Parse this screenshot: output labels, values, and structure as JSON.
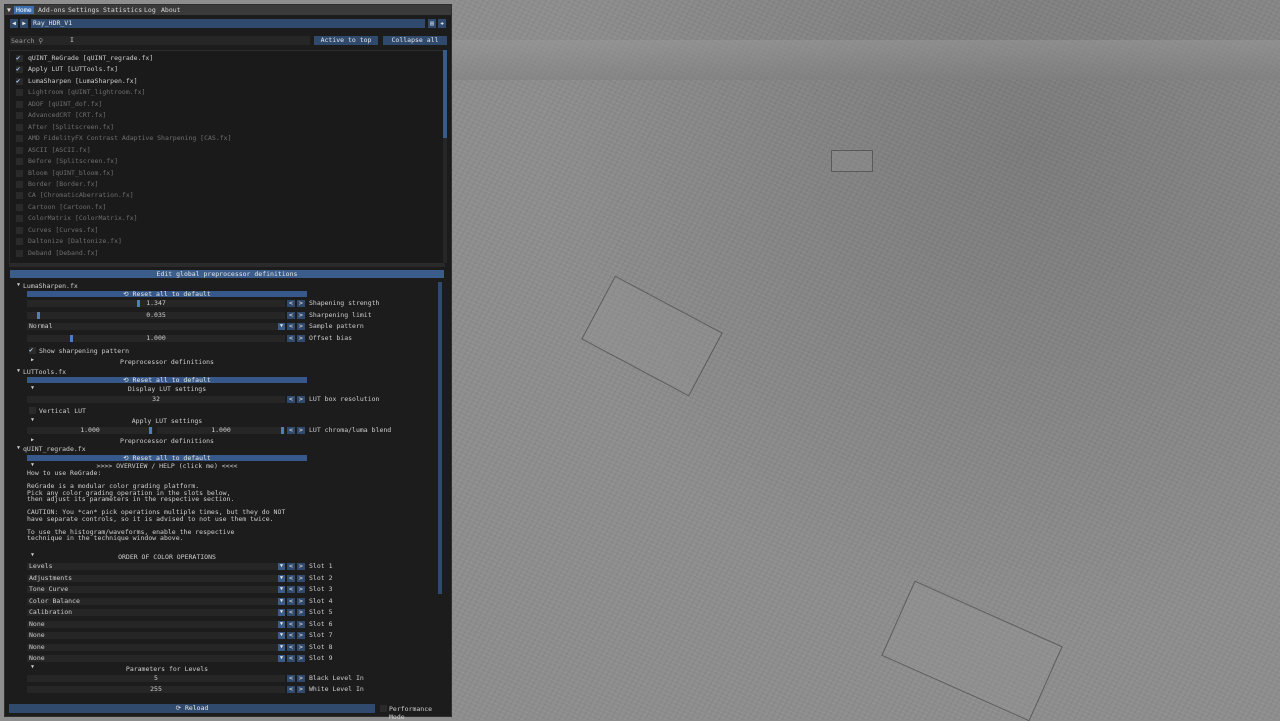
{
  "menu": {
    "items": [
      "Home",
      "Add-ons",
      "Settings",
      "Statistics",
      "Log",
      "About"
    ],
    "active_index": 0
  },
  "preset": {
    "prev_label": "◀",
    "next_label": "▶",
    "name": "Ray_HDR_V1",
    "save_icon": "save-icon",
    "add_icon": "plus-icon"
  },
  "search": {
    "label": "Search",
    "active_to_top": "Active to top",
    "collapse_all": "Collapse all"
  },
  "techniques": [
    {
      "name": "qUINT_ReGrade [qUINT_regrade.fx]",
      "enabled": true
    },
    {
      "name": "Apply LUT [LUTTools.fx]",
      "enabled": true
    },
    {
      "name": "LumaSharpen [LumaSharpen.fx]",
      "enabled": true
    },
    {
      "name": "Lightroom [qUINT_lightroom.fx]",
      "enabled": false
    },
    {
      "name": "ADOF [qUINT_dof.fx]",
      "enabled": false
    },
    {
      "name": "AdvancedCRT [CRT.fx]",
      "enabled": false
    },
    {
      "name": "After [Splitscreen.fx]",
      "enabled": false
    },
    {
      "name": "AMD FidelityFX Contrast Adaptive Sharpening [CAS.fx]",
      "enabled": false
    },
    {
      "name": "ASCII [ASCII.fx]",
      "enabled": false
    },
    {
      "name": "Before [Splitscreen.fx]",
      "enabled": false
    },
    {
      "name": "Bloom [qUINT_bloom.fx]",
      "enabled": false
    },
    {
      "name": "Border [Border.fx]",
      "enabled": false
    },
    {
      "name": "CA [ChromaticAberration.fx]",
      "enabled": false
    },
    {
      "name": "Cartoon [Cartoon.fx]",
      "enabled": false
    },
    {
      "name": "ColorMatrix [ColorMatrix.fx]",
      "enabled": false
    },
    {
      "name": "Curves [Curves.fx]",
      "enabled": false
    },
    {
      "name": "Daltonize [Daltonize.fx]",
      "enabled": false
    },
    {
      "name": "Deband [Deband.fx]",
      "enabled": false
    }
  ],
  "edit_global": "Edit global preprocessor definitions",
  "params": {
    "luma": {
      "header": "LumaSharpen.fx",
      "reset": "Reset all to default",
      "strength_value": "1.347",
      "strength_label": "Shapening strength",
      "strength_level": 0.43,
      "limit_value": "0.035",
      "limit_label": "Sharpening limit",
      "limit_level": 0.04,
      "pattern_value": "Normal",
      "pattern_label": "Sample pattern",
      "offset_value": "1.000",
      "offset_label": "Offset bias",
      "offset_level": 0.17,
      "show_pattern": "Show sharpening pattern",
      "preproc": "Preprocessor definitions"
    },
    "lut": {
      "header": "LUTTools.fx",
      "reset": "Reset all to default",
      "display_settings": "Display LUT settings",
      "box_value": "32",
      "box_label": "LUT box resolution",
      "vertical": "Vertical LUT",
      "apply_settings": "Apply LUT settings",
      "blend_a": "1.000",
      "blend_b": "1.000",
      "blend_label": "LUT chroma/luma blend",
      "preproc": "Preprocessor definitions"
    },
    "regrade": {
      "header": "qUINT_regrade.fx",
      "reset": "Reset all to default",
      "overview": ">>>> OVERVIEW / HELP (click me) <<<<",
      "help_lines": [
        "How to use ReGrade:",
        "",
        "ReGrade is a modular color grading platform.",
        "Pick any color grading operation in the slots below,",
        "then adjust its parameters in the respective section.",
        "",
        "CAUTION: You *can* pick operations multiple times, but they do NOT",
        "have separate controls, so it is advised to not use them twice.",
        "",
        "To use the histogram/waveforms, enable the respective",
        "technique in the technique window above."
      ],
      "order_title": "ORDER OF COLOR OPERATIONS",
      "slots": [
        {
          "value": "Levels",
          "label": "Slot 1"
        },
        {
          "value": "Adjustments",
          "label": "Slot 2"
        },
        {
          "value": "Tone Curve",
          "label": "Slot 3"
        },
        {
          "value": "Color Balance",
          "label": "Slot 4"
        },
        {
          "value": "Calibration",
          "label": "Slot 5"
        },
        {
          "value": "None",
          "label": "Slot 6"
        },
        {
          "value": "None",
          "label": "Slot 7"
        },
        {
          "value": "None",
          "label": "Slot 8"
        },
        {
          "value": "None",
          "label": "Slot 9"
        }
      ],
      "levels_title": "Parameters for Levels",
      "black_value": "5",
      "black_label": "Black Level In",
      "white_value": "255",
      "white_label": "White Level In"
    }
  },
  "bottom": {
    "reload": "Reload",
    "perf": "Performance Mode"
  },
  "colors": {
    "accent": "#3d6fb0",
    "button": "#304a6e",
    "panel": "#1c1c1c"
  }
}
